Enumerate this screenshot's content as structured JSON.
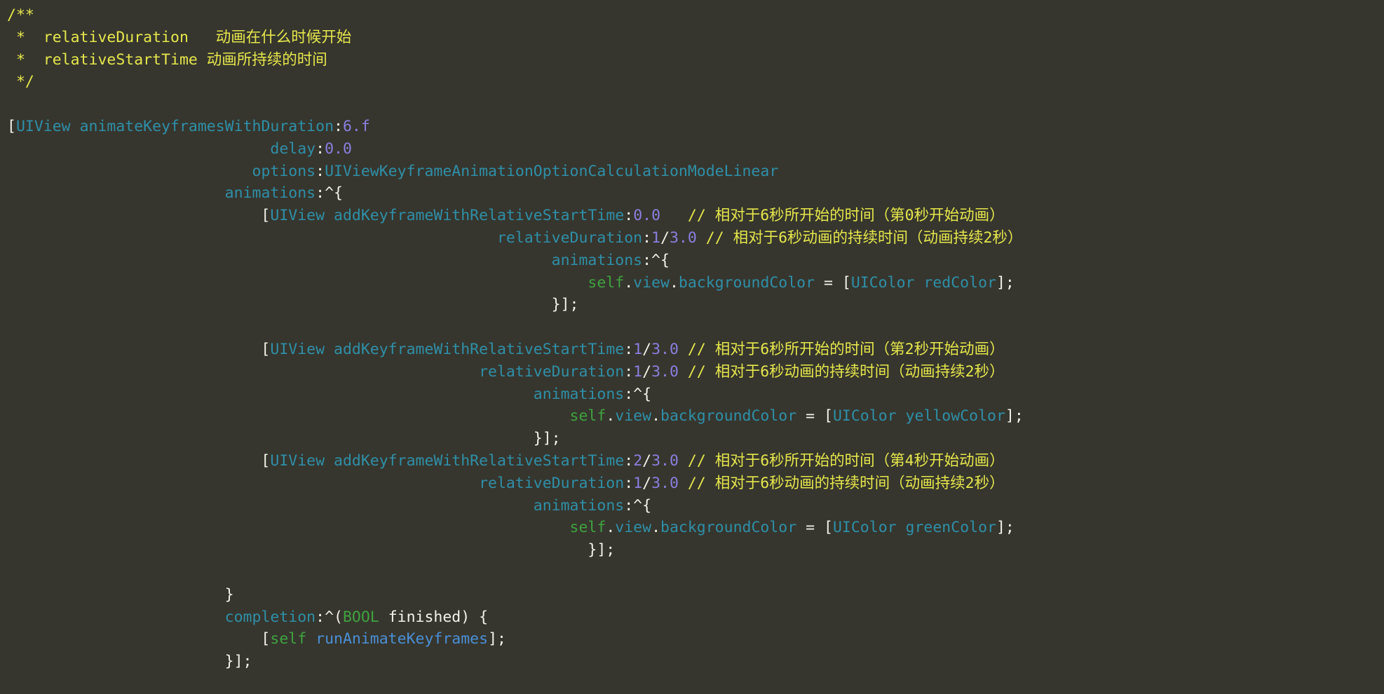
{
  "editor": {
    "background": "#36362e",
    "font_size_px": 21.5,
    "colors": {
      "comment": "#e6e64c",
      "type": "#2f8fa8",
      "number": "#8a7fe0",
      "plain": "#f2f2e8",
      "self_keyword": "#3fa23f",
      "message_name": "#4a8fd6"
    },
    "language": "objective-c",
    "lines": [
      {
        "id": "l1",
        "tokens": [
          {
            "t": "comment",
            "s": "/**"
          }
        ]
      },
      {
        "id": "l2",
        "tokens": [
          {
            "t": "comment",
            "s": " *  relativeDuration   动画在什么时候开始"
          }
        ]
      },
      {
        "id": "l3",
        "tokens": [
          {
            "t": "comment",
            "s": " *  relativeStartTime 动画所持续的时间"
          }
        ]
      },
      {
        "id": "l4",
        "tokens": [
          {
            "t": "comment",
            "s": " */"
          }
        ]
      },
      {
        "id": "l5",
        "tokens": [
          {
            "t": "plain",
            "s": ""
          }
        ]
      },
      {
        "id": "l6",
        "tokens": [
          {
            "t": "plain",
            "s": "["
          },
          {
            "t": "type",
            "s": "UIView"
          },
          {
            "t": "plain",
            "s": " "
          },
          {
            "t": "method",
            "s": "animateKeyframesWithDuration"
          },
          {
            "t": "plain",
            "s": ":"
          },
          {
            "t": "num",
            "s": "6.f"
          }
        ]
      },
      {
        "id": "l7",
        "tokens": [
          {
            "t": "plain",
            "s": "                             "
          },
          {
            "t": "param",
            "s": "delay"
          },
          {
            "t": "plain",
            "s": ":"
          },
          {
            "t": "num",
            "s": "0.0"
          }
        ]
      },
      {
        "id": "l8",
        "tokens": [
          {
            "t": "plain",
            "s": "                           "
          },
          {
            "t": "param",
            "s": "options"
          },
          {
            "t": "plain",
            "s": ":"
          },
          {
            "t": "type",
            "s": "UIViewKeyframeAnimationOptionCalculationModeLinear"
          }
        ]
      },
      {
        "id": "l9",
        "tokens": [
          {
            "t": "plain",
            "s": "                        "
          },
          {
            "t": "param",
            "s": "animations"
          },
          {
            "t": "plain",
            "s": ":^{"
          }
        ]
      },
      {
        "id": "l10",
        "tokens": [
          {
            "t": "plain",
            "s": "                            ["
          },
          {
            "t": "type",
            "s": "UIView"
          },
          {
            "t": "plain",
            "s": " "
          },
          {
            "t": "method",
            "s": "addKeyframeWithRelativeStartTime"
          },
          {
            "t": "plain",
            "s": ":"
          },
          {
            "t": "num",
            "s": "0.0"
          },
          {
            "t": "plain",
            "s": "   "
          },
          {
            "t": "comment",
            "s": "// 相对于6秒所开始的时间（第0秒开始动画）"
          }
        ]
      },
      {
        "id": "l11",
        "tokens": [
          {
            "t": "plain",
            "s": "                                                      "
          },
          {
            "t": "param",
            "s": "relativeDuration"
          },
          {
            "t": "plain",
            "s": ":"
          },
          {
            "t": "num",
            "s": "1"
          },
          {
            "t": "plain",
            "s": "/"
          },
          {
            "t": "num",
            "s": "3.0"
          },
          {
            "t": "plain",
            "s": " "
          },
          {
            "t": "comment",
            "s": "// 相对于6秒动画的持续时间（动画持续2秒）"
          }
        ]
      },
      {
        "id": "l12",
        "tokens": [
          {
            "t": "plain",
            "s": "                                                            "
          },
          {
            "t": "param",
            "s": "animations"
          },
          {
            "t": "plain",
            "s": ":^{"
          }
        ]
      },
      {
        "id": "l13",
        "tokens": [
          {
            "t": "plain",
            "s": "                                                                "
          },
          {
            "t": "self",
            "s": "self"
          },
          {
            "t": "plain",
            "s": "."
          },
          {
            "t": "prop",
            "s": "view"
          },
          {
            "t": "plain",
            "s": "."
          },
          {
            "t": "prop",
            "s": "backgroundColor"
          },
          {
            "t": "plain",
            "s": " = ["
          },
          {
            "t": "type",
            "s": "UIColor"
          },
          {
            "t": "plain",
            "s": " "
          },
          {
            "t": "method",
            "s": "redColor"
          },
          {
            "t": "plain",
            "s": "];"
          }
        ]
      },
      {
        "id": "l14",
        "tokens": [
          {
            "t": "plain",
            "s": "                                                            }];"
          }
        ]
      },
      {
        "id": "l15",
        "tokens": [
          {
            "t": "plain",
            "s": ""
          }
        ]
      },
      {
        "id": "l16",
        "tokens": [
          {
            "t": "plain",
            "s": "                            ["
          },
          {
            "t": "type",
            "s": "UIView"
          },
          {
            "t": "plain",
            "s": " "
          },
          {
            "t": "method",
            "s": "addKeyframeWithRelativeStartTime"
          },
          {
            "t": "plain",
            "s": ":"
          },
          {
            "t": "num",
            "s": "1"
          },
          {
            "t": "plain",
            "s": "/"
          },
          {
            "t": "num",
            "s": "3.0"
          },
          {
            "t": "plain",
            "s": " "
          },
          {
            "t": "comment",
            "s": "// 相对于6秒所开始的时间（第2秒开始动画）"
          }
        ]
      },
      {
        "id": "l17",
        "tokens": [
          {
            "t": "plain",
            "s": "                                                    "
          },
          {
            "t": "param",
            "s": "relativeDuration"
          },
          {
            "t": "plain",
            "s": ":"
          },
          {
            "t": "num",
            "s": "1"
          },
          {
            "t": "plain",
            "s": "/"
          },
          {
            "t": "num",
            "s": "3.0"
          },
          {
            "t": "plain",
            "s": " "
          },
          {
            "t": "comment",
            "s": "// 相对于6秒动画的持续时间（动画持续2秒）"
          }
        ]
      },
      {
        "id": "l18",
        "tokens": [
          {
            "t": "plain",
            "s": "                                                          "
          },
          {
            "t": "param",
            "s": "animations"
          },
          {
            "t": "plain",
            "s": ":^{"
          }
        ]
      },
      {
        "id": "l19",
        "tokens": [
          {
            "t": "plain",
            "s": "                                                              "
          },
          {
            "t": "self",
            "s": "self"
          },
          {
            "t": "plain",
            "s": "."
          },
          {
            "t": "prop",
            "s": "view"
          },
          {
            "t": "plain",
            "s": "."
          },
          {
            "t": "prop",
            "s": "backgroundColor"
          },
          {
            "t": "plain",
            "s": " = ["
          },
          {
            "t": "type",
            "s": "UIColor"
          },
          {
            "t": "plain",
            "s": " "
          },
          {
            "t": "method",
            "s": "yellowColor"
          },
          {
            "t": "plain",
            "s": "];"
          }
        ]
      },
      {
        "id": "l20",
        "tokens": [
          {
            "t": "plain",
            "s": "                                                          }];"
          }
        ]
      },
      {
        "id": "l21",
        "tokens": [
          {
            "t": "plain",
            "s": "                            ["
          },
          {
            "t": "type",
            "s": "UIView"
          },
          {
            "t": "plain",
            "s": " "
          },
          {
            "t": "method",
            "s": "addKeyframeWithRelativeStartTime"
          },
          {
            "t": "plain",
            "s": ":"
          },
          {
            "t": "num",
            "s": "2"
          },
          {
            "t": "plain",
            "s": "/"
          },
          {
            "t": "num",
            "s": "3.0"
          },
          {
            "t": "plain",
            "s": " "
          },
          {
            "t": "comment",
            "s": "// 相对于6秒所开始的时间（第4秒开始动画）"
          }
        ]
      },
      {
        "id": "l22",
        "tokens": [
          {
            "t": "plain",
            "s": "                                                    "
          },
          {
            "t": "param",
            "s": "relativeDuration"
          },
          {
            "t": "plain",
            "s": ":"
          },
          {
            "t": "num",
            "s": "1"
          },
          {
            "t": "plain",
            "s": "/"
          },
          {
            "t": "num",
            "s": "3.0"
          },
          {
            "t": "plain",
            "s": " "
          },
          {
            "t": "comment",
            "s": "// 相对于6秒动画的持续时间（动画持续2秒）"
          }
        ]
      },
      {
        "id": "l23",
        "tokens": [
          {
            "t": "plain",
            "s": "                                                          "
          },
          {
            "t": "param",
            "s": "animations"
          },
          {
            "t": "plain",
            "s": ":^{"
          }
        ]
      },
      {
        "id": "l24",
        "tokens": [
          {
            "t": "plain",
            "s": "                                                              "
          },
          {
            "t": "self",
            "s": "self"
          },
          {
            "t": "plain",
            "s": "."
          },
          {
            "t": "prop",
            "s": "view"
          },
          {
            "t": "plain",
            "s": "."
          },
          {
            "t": "prop",
            "s": "backgroundColor"
          },
          {
            "t": "plain",
            "s": " = ["
          },
          {
            "t": "type",
            "s": "UIColor"
          },
          {
            "t": "plain",
            "s": " "
          },
          {
            "t": "method",
            "s": "greenColor"
          },
          {
            "t": "plain",
            "s": "];"
          }
        ]
      },
      {
        "id": "l25",
        "tokens": [
          {
            "t": "plain",
            "s": "                                                                }];"
          }
        ]
      },
      {
        "id": "l26",
        "tokens": [
          {
            "t": "plain",
            "s": ""
          }
        ]
      },
      {
        "id": "l27",
        "tokens": [
          {
            "t": "plain",
            "s": "                        }"
          }
        ]
      },
      {
        "id": "l28",
        "tokens": [
          {
            "t": "plain",
            "s": "                        "
          },
          {
            "t": "param",
            "s": "completion"
          },
          {
            "t": "plain",
            "s": ":^("
          },
          {
            "t": "keyword",
            "s": "BOOL"
          },
          {
            "t": "plain",
            "s": " finished) {"
          }
        ]
      },
      {
        "id": "l29",
        "tokens": [
          {
            "t": "plain",
            "s": "                            ["
          },
          {
            "t": "self",
            "s": "self"
          },
          {
            "t": "plain",
            "s": " "
          },
          {
            "t": "msgname",
            "s": "runAnimateKeyframes"
          },
          {
            "t": "plain",
            "s": "];"
          }
        ]
      },
      {
        "id": "l30",
        "tokens": [
          {
            "t": "plain",
            "s": "                        }];"
          }
        ]
      }
    ]
  }
}
